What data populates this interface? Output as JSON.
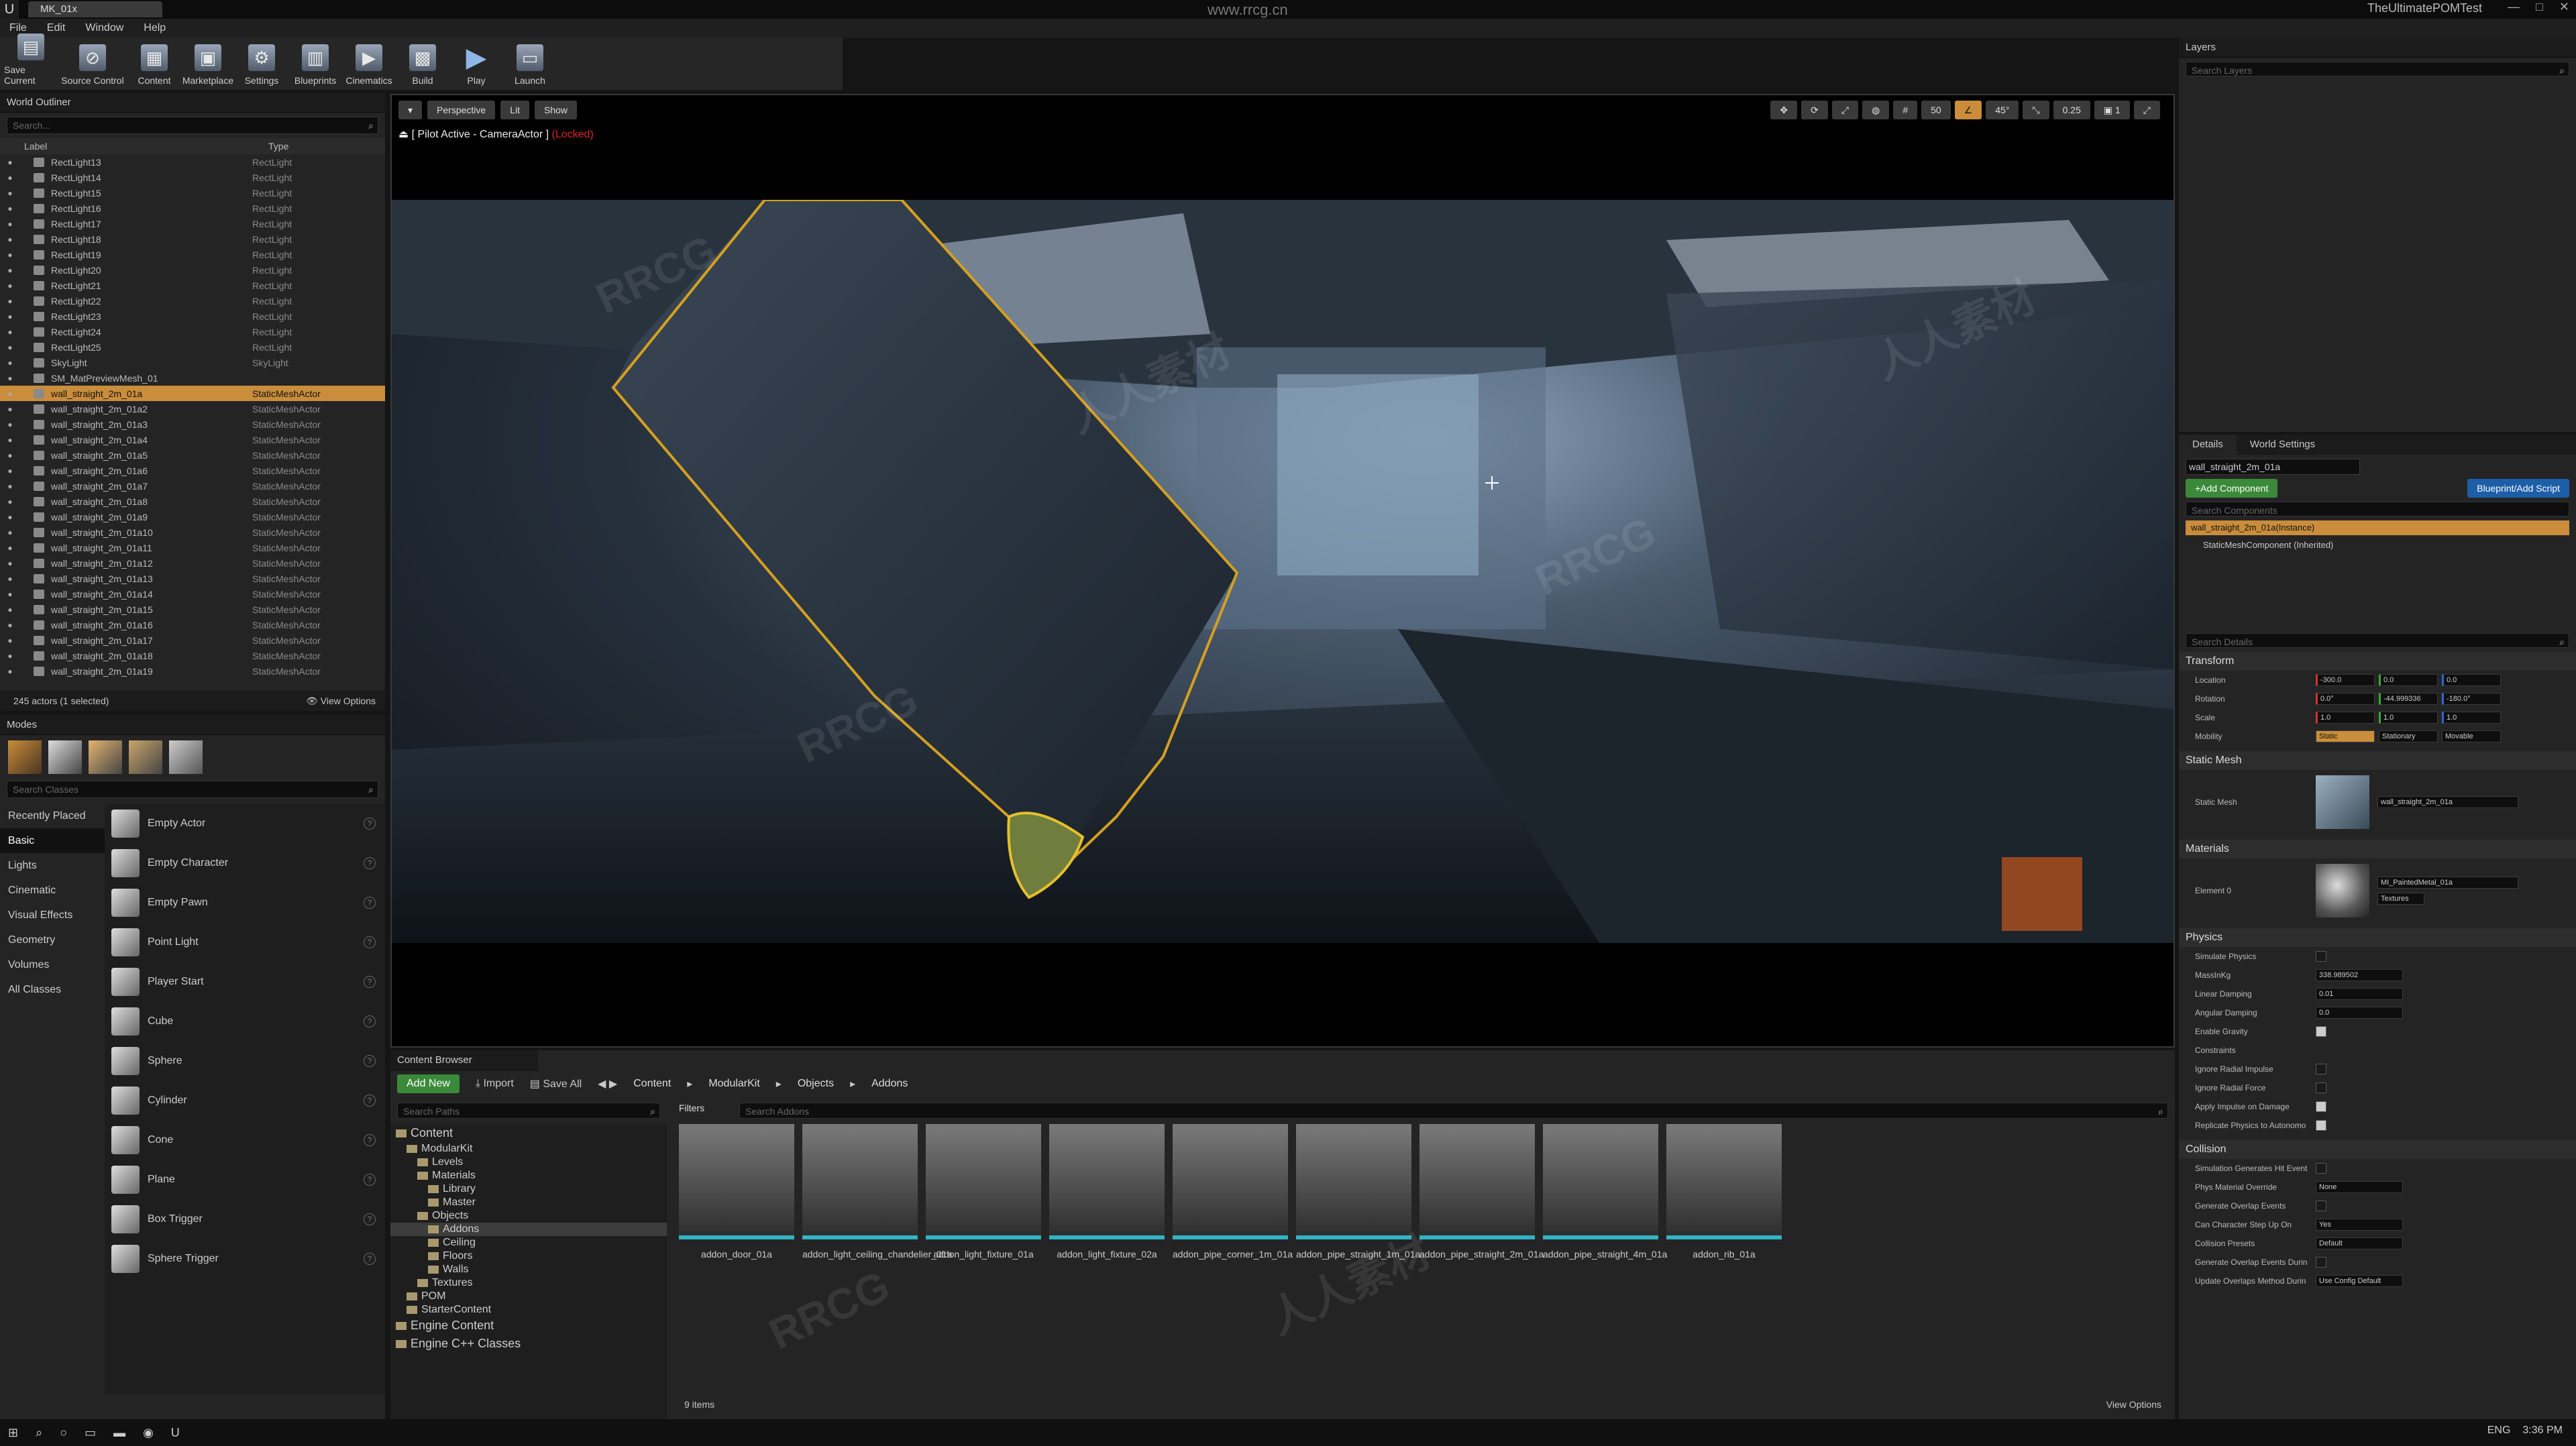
{
  "titlebar": {
    "tab": "MK_01x",
    "center": "www.rrcg.cn",
    "project": "TheUltimatePOMTest",
    "min": "—",
    "max": "□",
    "close": "✕"
  },
  "menu": [
    "File",
    "Edit",
    "Window",
    "Help"
  ],
  "toolbar": [
    {
      "label": "Save Current",
      "icon": "save-icon"
    },
    {
      "label": "Source Control",
      "icon": "source-control-icon"
    },
    {
      "label": "Content",
      "icon": "content-icon"
    },
    {
      "label": "Marketplace",
      "icon": "marketplace-icon"
    },
    {
      "label": "Settings",
      "icon": "gear-icon"
    },
    {
      "label": "Blueprints",
      "icon": "blueprints-icon"
    },
    {
      "label": "Cinematics",
      "icon": "cinematics-icon"
    },
    {
      "label": "Build",
      "icon": "build-icon"
    },
    {
      "label": "Play",
      "icon": "play-icon"
    },
    {
      "label": "Launch",
      "icon": "launch-icon"
    }
  ],
  "outliner": {
    "title": "World Outliner",
    "search": "Search...",
    "col_label": "Label",
    "col_type": "Type",
    "rows": [
      {
        "label": "RectLight13",
        "type": "RectLight"
      },
      {
        "label": "RectLight14",
        "type": "RectLight"
      },
      {
        "label": "RectLight15",
        "type": "RectLight"
      },
      {
        "label": "RectLight16",
        "type": "RectLight"
      },
      {
        "label": "RectLight17",
        "type": "RectLight"
      },
      {
        "label": "RectLight18",
        "type": "RectLight"
      },
      {
        "label": "RectLight19",
        "type": "RectLight"
      },
      {
        "label": "RectLight20",
        "type": "RectLight"
      },
      {
        "label": "RectLight21",
        "type": "RectLight"
      },
      {
        "label": "RectLight22",
        "type": "RectLight"
      },
      {
        "label": "RectLight23",
        "type": "RectLight"
      },
      {
        "label": "RectLight24",
        "type": "RectLight"
      },
      {
        "label": "RectLight25",
        "type": "RectLight"
      },
      {
        "label": "SkyLight",
        "type": "SkyLight"
      },
      {
        "label": "SM_MatPreviewMesh_01",
        "type": ""
      },
      {
        "label": "wall_straight_2m_01a",
        "type": "StaticMeshActor",
        "selected": true
      },
      {
        "label": "wall_straight_2m_01a2",
        "type": "StaticMeshActor"
      },
      {
        "label": "wall_straight_2m_01a3",
        "type": "StaticMeshActor"
      },
      {
        "label": "wall_straight_2m_01a4",
        "type": "StaticMeshActor"
      },
      {
        "label": "wall_straight_2m_01a5",
        "type": "StaticMeshActor"
      },
      {
        "label": "wall_straight_2m_01a6",
        "type": "StaticMeshActor"
      },
      {
        "label": "wall_straight_2m_01a7",
        "type": "StaticMeshActor"
      },
      {
        "label": "wall_straight_2m_01a8",
        "type": "StaticMeshActor"
      },
      {
        "label": "wall_straight_2m_01a9",
        "type": "StaticMeshActor"
      },
      {
        "label": "wall_straight_2m_01a10",
        "type": "StaticMeshActor"
      },
      {
        "label": "wall_straight_2m_01a11",
        "type": "StaticMeshActor"
      },
      {
        "label": "wall_straight_2m_01a12",
        "type": "StaticMeshActor"
      },
      {
        "label": "wall_straight_2m_01a13",
        "type": "StaticMeshActor"
      },
      {
        "label": "wall_straight_2m_01a14",
        "type": "StaticMeshActor"
      },
      {
        "label": "wall_straight_2m_01a15",
        "type": "StaticMeshActor"
      },
      {
        "label": "wall_straight_2m_01a16",
        "type": "StaticMeshActor"
      },
      {
        "label": "wall_straight_2m_01a17",
        "type": "StaticMeshActor"
      },
      {
        "label": "wall_straight_2m_01a18",
        "type": "StaticMeshActor"
      },
      {
        "label": "wall_straight_2m_01a19",
        "type": "StaticMeshActor"
      }
    ],
    "status": "245 actors (1 selected)",
    "view_options": "View Options"
  },
  "modes": {
    "title": "Modes",
    "search": "Search Classes",
    "categories": [
      "Recently Placed",
      "Basic",
      "Lights",
      "Cinematic",
      "Visual Effects",
      "Geometry",
      "Volumes",
      "All Classes"
    ],
    "selected": "Basic",
    "items": [
      "Empty Actor",
      "Empty Character",
      "Empty Pawn",
      "Point Light",
      "Player Start",
      "Cube",
      "Sphere",
      "Cylinder",
      "Cone",
      "Plane",
      "Box Trigger",
      "Sphere Trigger"
    ]
  },
  "viewport": {
    "perspective": "Perspective",
    "lit": "Lit",
    "show": "Show",
    "pilot": "[ Pilot Active - CameraActor ]",
    "locked": "(Locked)",
    "grid": "50",
    "angle": "45°",
    "scale": "0.25",
    "cams": "1"
  },
  "content_browser": {
    "title": "Content Browser",
    "add_new": "Add New",
    "import": "Import",
    "save_all": "Save All",
    "path": [
      "Content",
      "ModularKit",
      "Objects",
      "Addons"
    ],
    "search_paths": "Search Paths",
    "filters": "Filters",
    "search_assets": "Search Addons",
    "tree": [
      {
        "label": "Content",
        "depth": 0,
        "big": true
      },
      {
        "label": "ModularKit",
        "depth": 1
      },
      {
        "label": "Levels",
        "depth": 2
      },
      {
        "label": "Materials",
        "depth": 2
      },
      {
        "label": "Library",
        "depth": 3
      },
      {
        "label": "Master",
        "depth": 3
      },
      {
        "label": "Objects",
        "depth": 2
      },
      {
        "label": "Addons",
        "depth": 3,
        "selected": true
      },
      {
        "label": "Ceiling",
        "depth": 3
      },
      {
        "label": "Floors",
        "depth": 3
      },
      {
        "label": "Walls",
        "depth": 3
      },
      {
        "label": "Textures",
        "depth": 2
      },
      {
        "label": "POM",
        "depth": 1
      },
      {
        "label": "StarterContent",
        "depth": 1
      },
      {
        "label": "Engine Content",
        "depth": 0,
        "big": true
      },
      {
        "label": "Engine C++ Classes",
        "depth": 0,
        "big": true
      }
    ],
    "assets": [
      "addon_door_01a",
      "addon_light_ceiling_chandelier_01a",
      "addon_light_fixture_01a",
      "addon_light_fixture_02a",
      "addon_pipe_corner_1m_01a",
      "addon_pipe_straight_1m_01a",
      "addon_pipe_straight_2m_01a",
      "addon_pipe_straight_4m_01a",
      "addon_rib_01a"
    ],
    "count": "9 items",
    "view_options": "View Options"
  },
  "layers": {
    "title": "Layers",
    "search": "Search Layers"
  },
  "details": {
    "tab": "Details",
    "tab2": "World Settings",
    "actor": "wall_straight_2m_01a",
    "add_component": "+Add Component",
    "blueprint": "Blueprint/Add Script",
    "search_components": "Search Components",
    "instance": "wall_straight_2m_01a(Instance)",
    "component": "StaticMeshComponent (Inherited)",
    "search_details": "Search Details",
    "transform": "Transform",
    "location": {
      "label": "Location",
      "x": "-300.0",
      "y": "0.0",
      "z": "0.0"
    },
    "rotation": {
      "label": "Rotation",
      "x": "0.0°",
      "y": "-44.999336",
      "z": "-180.0°"
    },
    "scale": {
      "label": "Scale",
      "x": "1.0",
      "y": "1.0",
      "z": "1.0"
    },
    "mobility": {
      "label": "Mobility",
      "opts": [
        "Static",
        "Stationary",
        "Movable"
      ]
    },
    "static_mesh_section": "Static Mesh",
    "static_mesh_label": "Static Mesh",
    "static_mesh_value": "wall_straight_2m_01a",
    "materials": "Materials",
    "element0": "Element 0",
    "material_value": "MI_PaintedMetal_01a",
    "textures": "Textures",
    "physics": "Physics",
    "physics_rows": [
      {
        "label": "Simulate Physics",
        "type": "check",
        "on": false
      },
      {
        "label": "MassInKg",
        "type": "field",
        "value": "338.989502"
      },
      {
        "label": "Linear Damping",
        "type": "field",
        "value": "0.01"
      },
      {
        "label": "Angular Damping",
        "type": "field",
        "value": "0.0"
      },
      {
        "label": "Enable Gravity",
        "type": "check",
        "on": true
      },
      {
        "label": "Constraints",
        "type": "none"
      },
      {
        "label": "Ignore Radial Impulse",
        "type": "check",
        "on": false
      },
      {
        "label": "Ignore Radial Force",
        "type": "check",
        "on": false
      },
      {
        "label": "Apply Impulse on Damage",
        "type": "check",
        "on": true
      },
      {
        "label": "Replicate Physics to Autonomo",
        "type": "check",
        "on": true
      }
    ],
    "collision": "Collision",
    "collision_rows": [
      {
        "label": "Simulation Generates Hit Event",
        "type": "check",
        "on": false
      },
      {
        "label": "Phys Material Override",
        "type": "field",
        "value": "None"
      },
      {
        "label": "Generate Overlap Events",
        "type": "check",
        "on": false
      },
      {
        "label": "Can Character Step Up On",
        "type": "field",
        "value": "Yes"
      },
      {
        "label": "Collision Presets",
        "type": "field",
        "value": "Default"
      },
      {
        "label": "Generate Overlap Events Durin",
        "type": "check",
        "on": false
      },
      {
        "label": "Update Overlaps Method Durin",
        "type": "field",
        "value": "Use Config Default"
      }
    ]
  },
  "taskbar": {
    "lang": "ENG",
    "time": "3:36 PM"
  },
  "watermarks": [
    "RRCG",
    "人人素材"
  ],
  "colors": {
    "selection": "#c98d3b",
    "accent_green": "#3a8a3a",
    "asset_underline": "#2fb4c6"
  }
}
